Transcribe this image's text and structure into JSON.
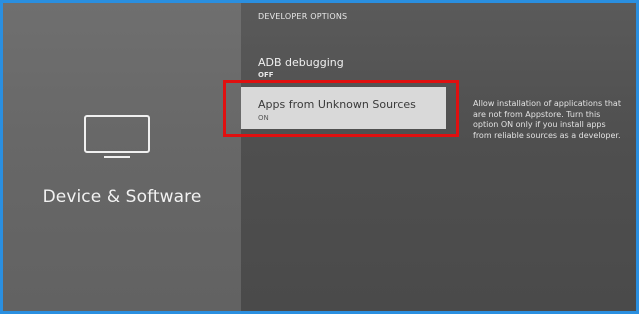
{
  "left_panel": {
    "icon": "tv-icon",
    "title": "Device & Software"
  },
  "section_heading": "DEVELOPER OPTIONS",
  "menu_items": [
    {
      "label": "ADB debugging",
      "value": "OFF"
    },
    {
      "label": "Apps from Unknown Sources",
      "value": "ON",
      "focused": true
    }
  ],
  "help_text": "Allow installation of applications that are not from Appstore. Turn this option ON only if you install apps from reliable sources as a developer.",
  "colors": {
    "outer_border": "#2a8fe0",
    "highlight_border": "#e01010",
    "focused_item_bg": "#d9d9d9"
  }
}
